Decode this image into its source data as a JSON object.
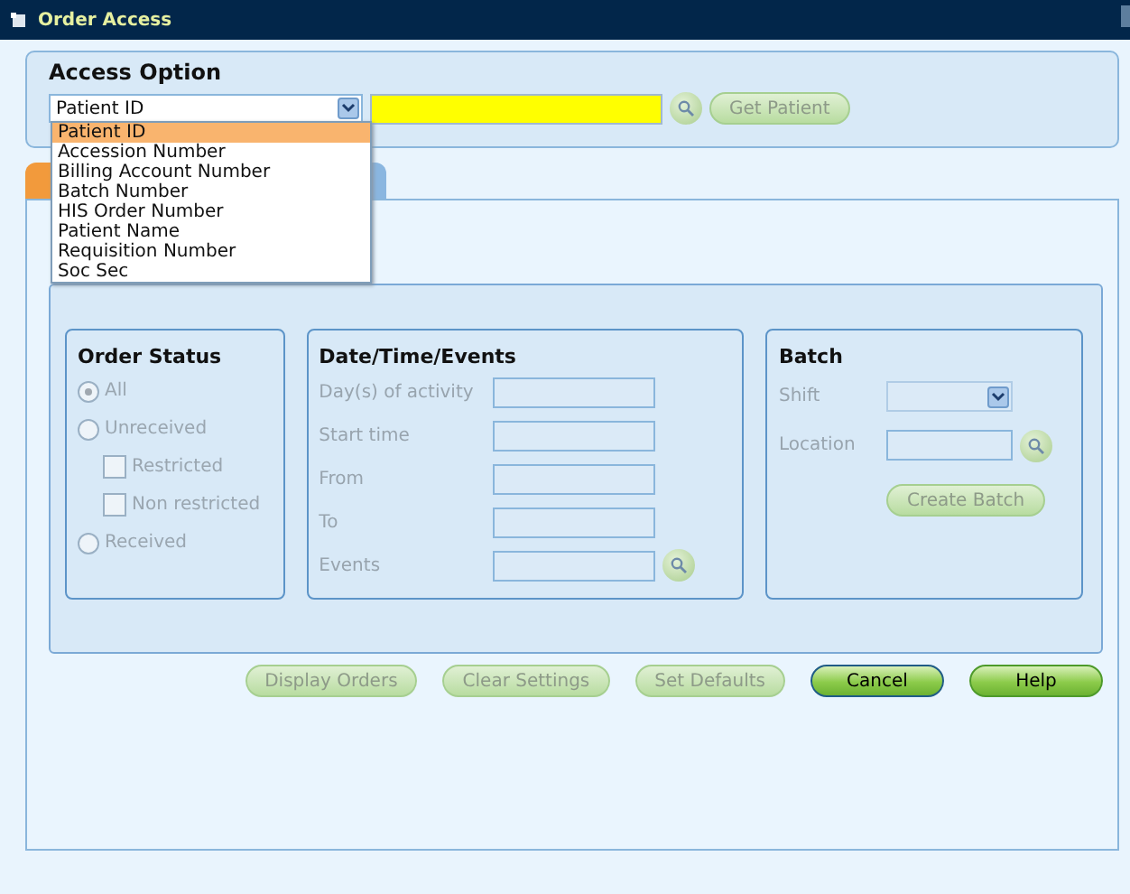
{
  "window": {
    "title": "Order Access"
  },
  "access_option": {
    "title": "Access Option",
    "select_value": "Patient ID",
    "dropdown_open": true,
    "button": "Get Patient",
    "options": [
      {
        "label": "Patient ID",
        "selected": true
      },
      {
        "label": "Accession Number",
        "selected": false
      },
      {
        "label": "Billing Account Number",
        "selected": false
      },
      {
        "label": "Batch Number",
        "selected": false
      },
      {
        "label": "HIS Order Number",
        "selected": false
      },
      {
        "label": "Patient Name",
        "selected": false
      },
      {
        "label": "Requisition Number",
        "selected": false
      },
      {
        "label": "Soc Sec",
        "selected": false
      }
    ]
  },
  "tabs": [
    {
      "selected": true
    },
    {
      "selected": false
    }
  ],
  "order_status": {
    "title": "Order Status",
    "items": [
      {
        "kind": "radio",
        "label": "All",
        "selected": true,
        "disabled": true
      },
      {
        "kind": "radio",
        "label": "Unreceived",
        "selected": false,
        "disabled": true
      },
      {
        "kind": "checkbox",
        "label": "Restricted",
        "checked": false,
        "disabled": true
      },
      {
        "kind": "checkbox",
        "label": "Non restricted",
        "checked": false,
        "disabled": true
      },
      {
        "kind": "radio",
        "label": "Received",
        "selected": false,
        "disabled": true
      }
    ]
  },
  "date_time_events": {
    "title": "Date/Time/Events",
    "fields": [
      {
        "label": "Day(s) of activity",
        "lookup": false
      },
      {
        "label": "Start time",
        "lookup": false
      },
      {
        "label": "From",
        "lookup": false
      },
      {
        "label": "To",
        "lookup": false
      },
      {
        "label": "Events",
        "lookup": true
      }
    ]
  },
  "batch": {
    "title": "Batch",
    "fields": [
      {
        "kind": "select",
        "label": "Shift"
      },
      {
        "kind": "lookup",
        "label": "Location"
      }
    ],
    "button": "Create Batch"
  },
  "buttons": [
    {
      "label": "Display Orders",
      "disabled": true,
      "default": false
    },
    {
      "label": "Clear Settings",
      "disabled": true,
      "default": false
    },
    {
      "label": "Set Defaults",
      "disabled": true,
      "default": false
    },
    {
      "label": "Cancel",
      "disabled": false,
      "default": true
    },
    {
      "label": "Help",
      "disabled": false,
      "default": false
    }
  ]
}
